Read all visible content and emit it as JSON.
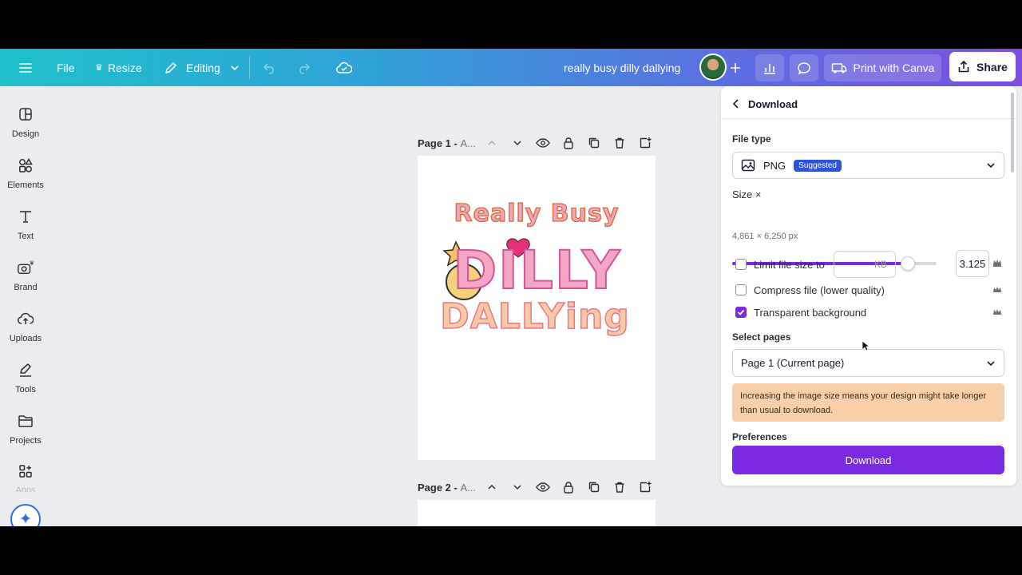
{
  "topbar": {
    "file_label": "File",
    "resize_label": "Resize",
    "editing_label": "Editing",
    "doc_title": "really busy dilly dallying",
    "print_label": "Print with Canva",
    "share_label": "Share"
  },
  "sidebar": {
    "items": [
      {
        "label": "Design"
      },
      {
        "label": "Elements"
      },
      {
        "label": "Text"
      },
      {
        "label": "Brand"
      },
      {
        "label": "Uploads"
      },
      {
        "label": "Tools"
      },
      {
        "label": "Projects"
      },
      {
        "label": "Apps"
      }
    ]
  },
  "pages": [
    {
      "title": "Page 1 - ",
      "subtitle": "A..."
    },
    {
      "title": "Page 2 - ",
      "subtitle": "A..."
    }
  ],
  "design_text": {
    "line1": "Really Busy",
    "line2": "DILLY",
    "line3": "DALLYing"
  },
  "download_panel": {
    "title": "Download",
    "file_type_label": "File type",
    "file_type_value": "PNG",
    "suggested_badge": "Suggested",
    "size_label": "Size ×",
    "size_value": "3.125",
    "size_fraction": 0.86,
    "dimensions": "4,861 × 6,250 px",
    "limit_size_label": "Limit file size to",
    "kb_unit": "KB",
    "compress_label": "Compress file (lower quality)",
    "transparent_label": "Transparent background",
    "select_pages_label": "Select pages",
    "select_pages_value": "Page 1 (Current page)",
    "warning_text": "Increasing the image size means your design might take longer than usual to download.",
    "preferences_label": "Preferences",
    "download_button": "Download"
  },
  "colors": {
    "accent": "#7a2be2",
    "badge": "#2e54d6",
    "warning_bg": "#f8cfa8"
  }
}
